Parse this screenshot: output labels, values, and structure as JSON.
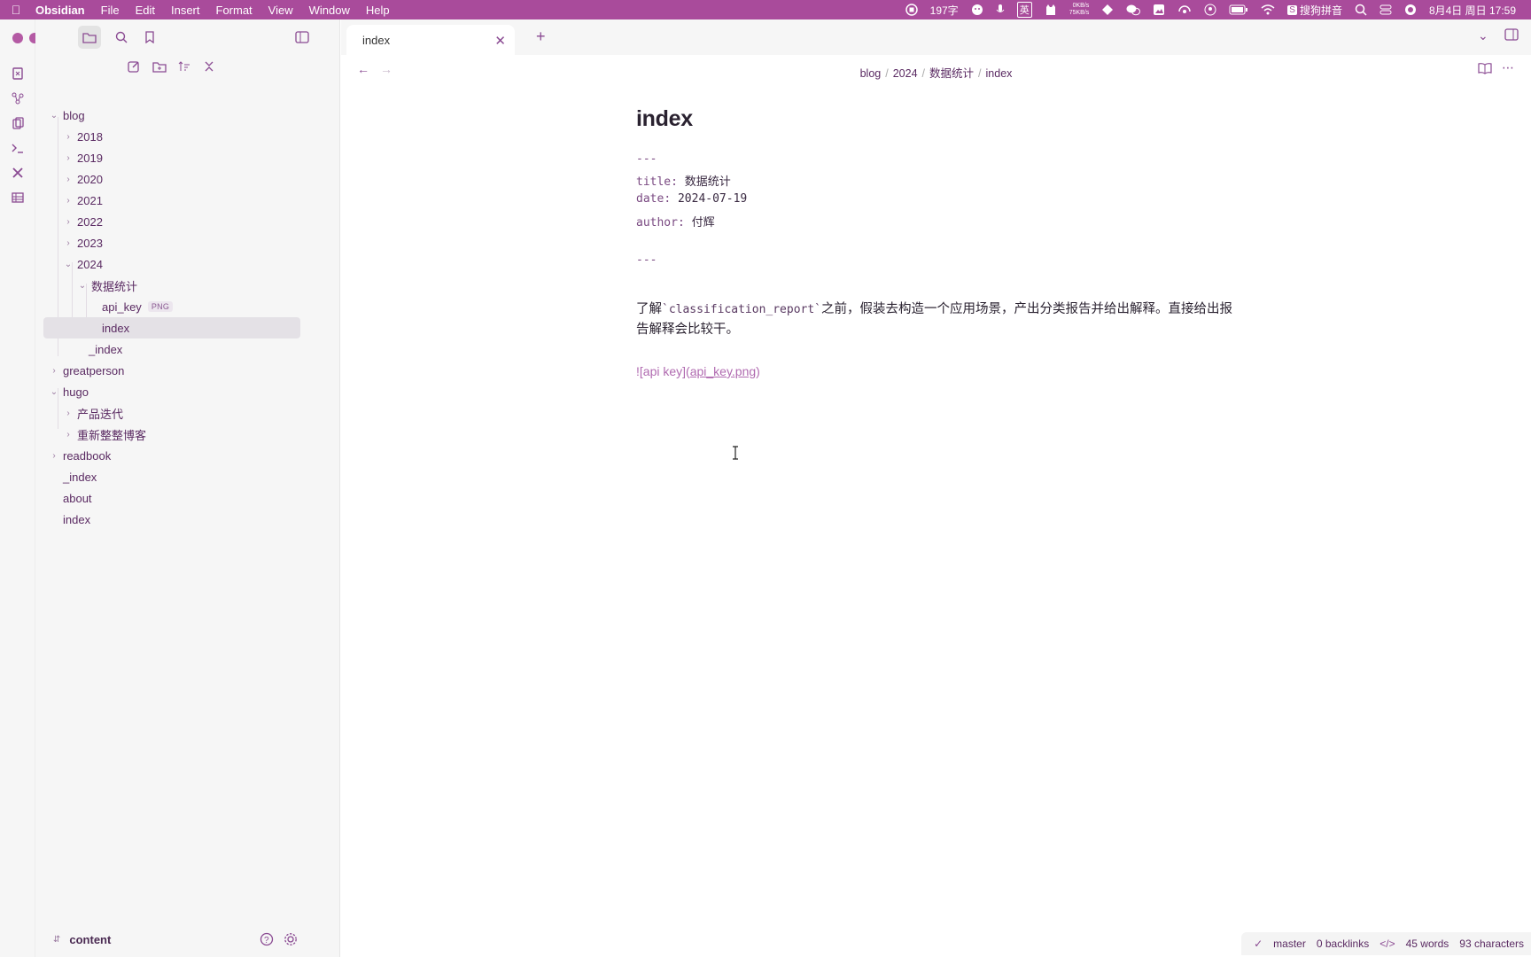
{
  "menubar": {
    "app_name": "Obsidian",
    "menus": [
      "File",
      "Edit",
      "Insert",
      "Format",
      "View",
      "Window",
      "Help"
    ],
    "word_count_indicator": "197字",
    "input_lang": "英",
    "net_up": "0KB/s",
    "net_down": "75KB/s",
    "ime": "搜狗拼音",
    "datetime": "8月4日 周日  17:59"
  },
  "sidebar": {
    "tree": [
      {
        "label": "blog",
        "level": 0,
        "state": "open"
      },
      {
        "label": "2018",
        "level": 1,
        "state": "closed"
      },
      {
        "label": "2019",
        "level": 1,
        "state": "closed"
      },
      {
        "label": "2020",
        "level": 1,
        "state": "closed"
      },
      {
        "label": "2021",
        "level": 1,
        "state": "closed"
      },
      {
        "label": "2022",
        "level": 1,
        "state": "closed"
      },
      {
        "label": "2023",
        "level": 1,
        "state": "closed"
      },
      {
        "label": "2024",
        "level": 1,
        "state": "open"
      },
      {
        "label": "数据统计",
        "level": 2,
        "state": "open"
      },
      {
        "label": "api_key",
        "level": 3,
        "state": "file",
        "badge": "PNG"
      },
      {
        "label": "index",
        "level": 3,
        "state": "file",
        "selected": true
      },
      {
        "label": "_index",
        "level": 2,
        "state": "file"
      },
      {
        "label": "greatperson",
        "level": 0,
        "state": "closed"
      },
      {
        "label": "hugo",
        "level": 0,
        "state": "open"
      },
      {
        "label": "产品迭代",
        "level": 1,
        "state": "closed"
      },
      {
        "label": "重新整整博客",
        "level": 1,
        "state": "closed"
      },
      {
        "label": "readbook",
        "level": 0,
        "state": "closed"
      },
      {
        "label": "_index",
        "level": 0,
        "state": "file"
      },
      {
        "label": "about",
        "level": 0,
        "state": "file"
      },
      {
        "label": "index",
        "level": 0,
        "state": "file"
      }
    ],
    "vault_name": "content"
  },
  "tab": {
    "label": "index"
  },
  "breadcrumb": [
    "blog",
    "2024",
    "数据统计",
    "index"
  ],
  "document": {
    "title": "index",
    "fm_open": "---",
    "frontmatter": [
      {
        "key": "title",
        "value": "数据统计"
      },
      {
        "key": "date",
        "value": "2024-07-19"
      },
      {
        "key": "author",
        "value": "付辉"
      }
    ],
    "fm_close": "---",
    "para_before": "了解",
    "para_code": "`classification_report`",
    "para_after": "之前，假装去构造一个应用场景，产出分类报告并给出解释。直接给出报告解释会比较干。",
    "embed_alt": "![api key]",
    "embed_open": "(",
    "embed_link": "api_key.png",
    "embed_close": ")"
  },
  "statusbar": {
    "branch": "master",
    "backlinks": "0 backlinks",
    "words": "45 words",
    "characters": "93 characters"
  }
}
